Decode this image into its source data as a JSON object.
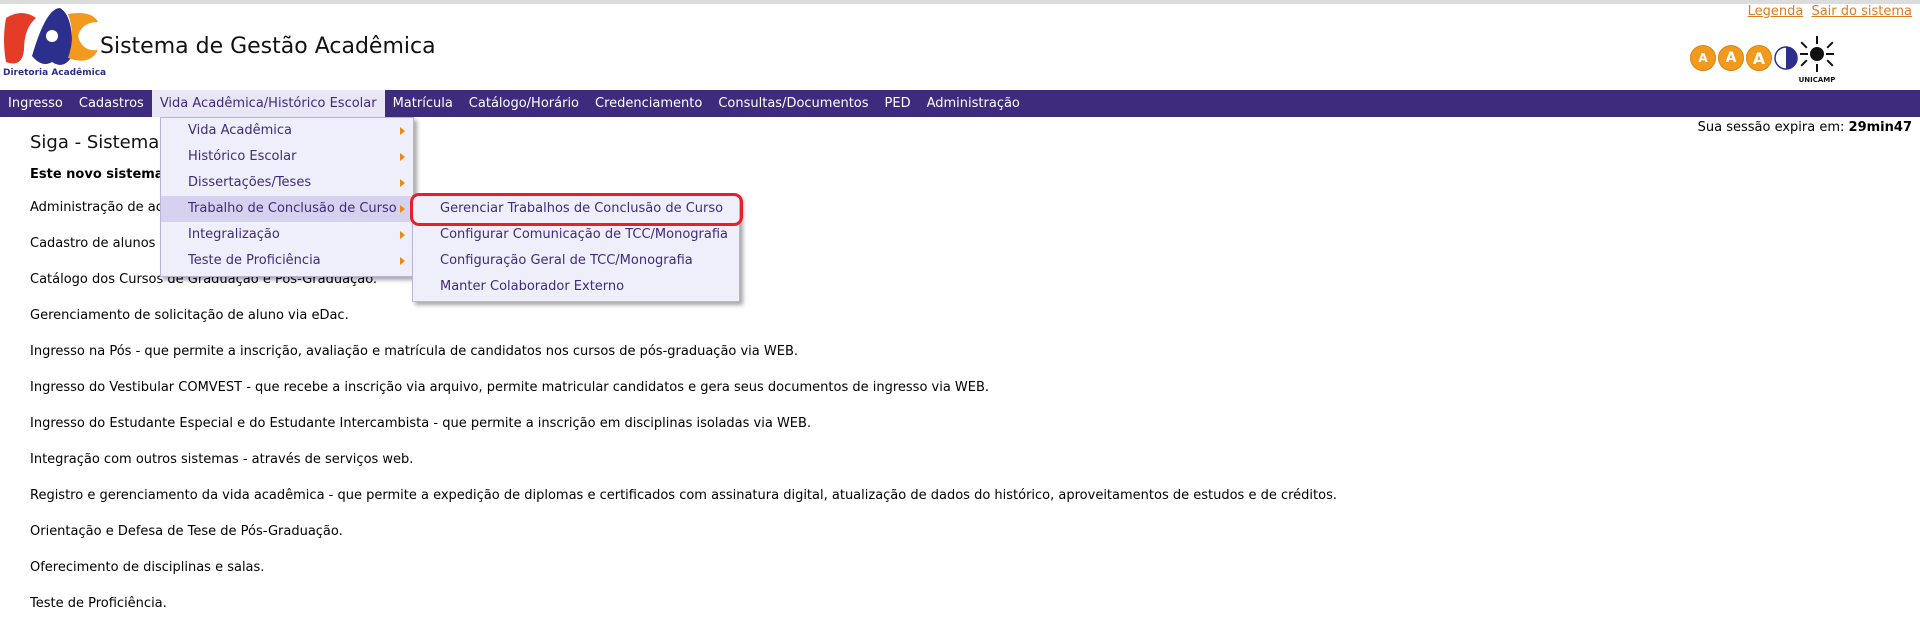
{
  "header": {
    "logo_caption": "Diretoria Acadêmica",
    "app_title": "Sistema de Gestão Acadêmica",
    "links": [
      "Legenda",
      "Sair do sistema"
    ],
    "font_sizes": [
      "A",
      "A",
      "A"
    ],
    "contrast_icon": "contrast-icon",
    "unicamp_logo_text": "UNICAMP"
  },
  "menubar": {
    "items": [
      "Ingresso",
      "Cadastros",
      "Vida Acadêmica/Histórico Escolar",
      "Matrícula",
      "Catálogo/Horário",
      "Credenciamento",
      "Consultas/Documentos",
      "PED",
      "Administração"
    ],
    "active_index": 2
  },
  "dropdown": {
    "items": [
      "Vida Acadêmica",
      "Histórico Escolar",
      "Dissertações/Teses",
      "Trabalho de Conclusão de Curso",
      "Integralização",
      "Teste de Proficiência"
    ],
    "hovered_index": 3
  },
  "submenu": {
    "items": [
      "Gerenciar Trabalhos de Conclusão de Curso",
      "Configurar Comunicação de TCC/Monografia",
      "Configuração Geral de TCC/Monografia",
      "Manter Colaborador Externo"
    ],
    "highlighted_index": 0
  },
  "session": {
    "label": "Sua sessão expira em:",
    "time": "29min47"
  },
  "content": {
    "title": "Siga - Sistema",
    "intro": "Este novo sistema",
    "features": [
      "Administração de ace",
      "Cadastro de alunos -",
      "Catálogo dos Cursos de Graduação e Pós-Graduação.",
      "Gerenciamento de solicitação de aluno via eDac.",
      "Ingresso na Pós - que permite a inscrição, avaliação e matrícula de candidatos nos cursos de pós-graduação via WEB.",
      "Ingresso do Vestibular COMVEST - que recebe a inscrição via arquivo, permite matricular candidatos e gera seus documentos de ingresso via WEB.",
      "Ingresso do Estudante Especial e do Estudante Intercambista - que permite a inscrição em disciplinas isoladas via WEB.",
      "Integração com outros sistemas - através de serviços web.",
      "Registro e gerenciamento da vida acadêmica - que permite a expedição de diplomas e certificados com assinatura digital, atualização de dados do histórico, aproveitamentos de estudos e de créditos.",
      "Orientação e Defesa de Tese de Pós-Graduação.",
      "Oferecimento de disciplinas e salas.",
      "Teste de Proficiência."
    ]
  },
  "colors": {
    "menubar": "#3f2b7e",
    "link": "#e07a1f",
    "highlight_ring": "#e6202a",
    "font_button": "#f39a1e"
  }
}
